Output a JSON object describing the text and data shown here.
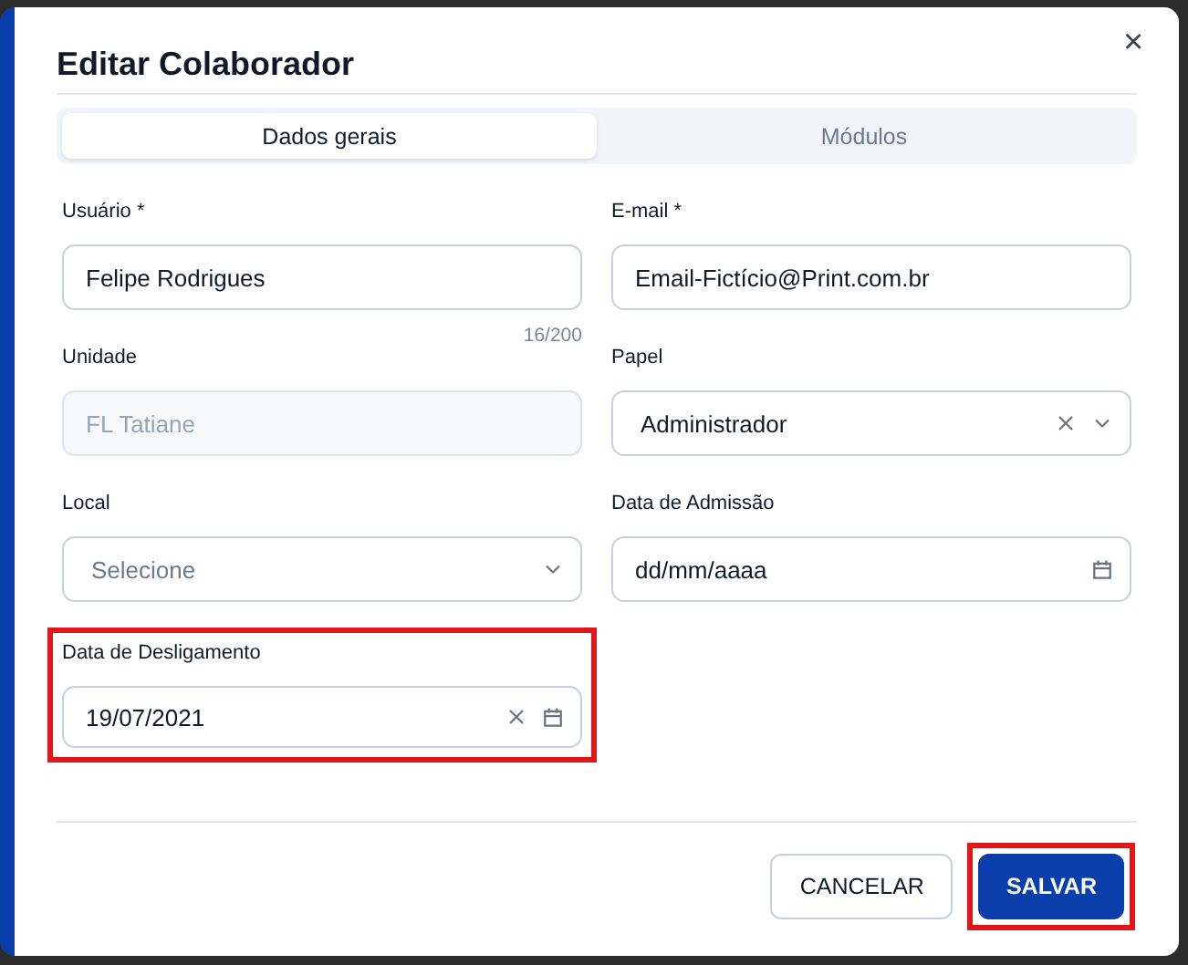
{
  "dialog": {
    "title": "Editar Colaborador",
    "close": "×"
  },
  "tabs": [
    {
      "label": "Dados gerais",
      "selected": true
    },
    {
      "label": "Módulos",
      "selected": false
    }
  ],
  "fields": [
    {
      "label": "Usuário *",
      "kind": "text",
      "value": "Felipe Rodrigues",
      "counter": "16/200",
      "highlighted": false
    },
    {
      "label": "E-mail *",
      "kind": "text",
      "value": "Email-Fictício@Print.com.br",
      "highlighted": false
    },
    {
      "label": "Unidade",
      "kind": "text",
      "value": "FL Tatiane",
      "disabled": true,
      "highlighted": false
    },
    {
      "label": "Papel",
      "kind": "select",
      "value": "Administrador",
      "clearable": true,
      "highlighted": false
    },
    {
      "label": "Local",
      "kind": "select",
      "placeholder": "Selecione",
      "clearable": false,
      "highlighted": false
    },
    {
      "label": "Data de Admissão",
      "kind": "date",
      "placeholder": "dd/mm/aaaa",
      "clearable": false,
      "highlighted": false
    },
    {
      "label": "Data de Desligamento",
      "kind": "date",
      "value": "19/07/2021",
      "clearable": true,
      "highlighted": true
    }
  ],
  "buttons": [
    {
      "label": "CANCELAR",
      "kind": "secondary",
      "highlighted": false
    },
    {
      "label": "SALVAR",
      "kind": "primary",
      "highlighted": true
    }
  ]
}
